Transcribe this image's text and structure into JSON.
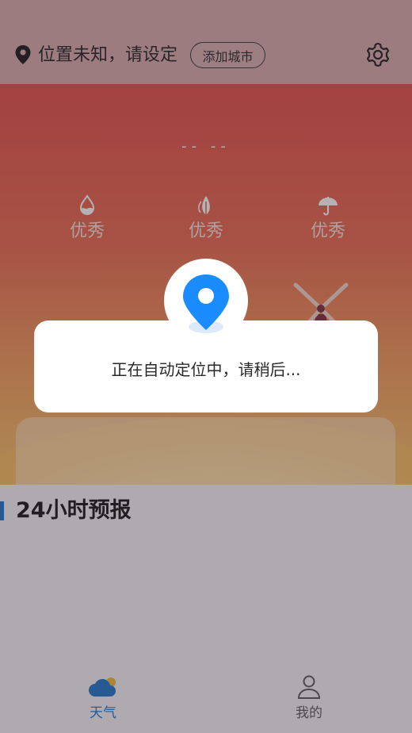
{
  "header": {
    "location_text": "位置未知，请设定",
    "add_city_label": "添加城市"
  },
  "weather": {
    "temperature": "-- --",
    "metrics": [
      {
        "icon": "humidity-drop-icon",
        "label": "优秀"
      },
      {
        "icon": "leaf-icon",
        "label": "优秀"
      },
      {
        "icon": "umbrella-icon",
        "label": "优秀"
      }
    ]
  },
  "dialog": {
    "message": "正在自动定位中，请稍后..."
  },
  "forecast": {
    "title": "24小时预报"
  },
  "nav": {
    "items": [
      {
        "label": "天气",
        "icon": "weather-cloud-icon",
        "active": true
      },
      {
        "label": "我的",
        "icon": "person-icon",
        "active": false
      }
    ]
  },
  "colors": {
    "accent": "#1a8cff",
    "active_nav": "#1a73c9",
    "inactive_nav": "#555555"
  }
}
